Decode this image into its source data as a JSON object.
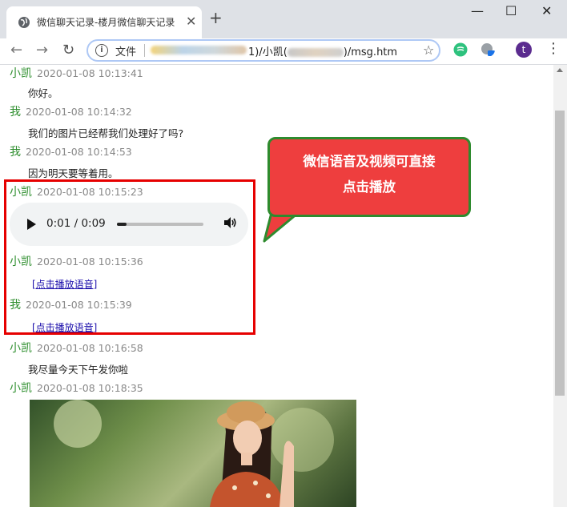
{
  "browser": {
    "tab_title": "微信聊天记录-楼月微信聊天记录",
    "tab_close_glyph": "✕",
    "new_tab_glyph": "+",
    "window_controls": [
      "—",
      "☐",
      "✕"
    ],
    "nav": {
      "back": "←",
      "forward": "→",
      "reload": "↻"
    },
    "address": {
      "info_glyph": "i",
      "file_label": "文件",
      "url_visible_1": "1)/小凯(",
      "url_visible_2": ")/msg.htm"
    },
    "star_glyph": "☆",
    "profile_initial": "t",
    "menu_glyph": "⋮",
    "colors": {
      "ext_green": "#2ec27e",
      "ext_gray": "#9aa0a6",
      "ext_blue": "#1a73e8",
      "avatar": "#5b2c8f"
    }
  },
  "messages": [
    {
      "sender": "小凯",
      "time": "2020-01-08 10:13:41",
      "text": "你好。"
    },
    {
      "sender": "我",
      "time": "2020-01-08 10:14:32",
      "text": "我们的图片已经帮我们处理好了吗?"
    },
    {
      "sender": "我",
      "time": "2020-01-08 10:14:53",
      "text": "因为明天要等着用。"
    },
    {
      "sender": "小凯",
      "time": "2020-01-08 10:15:23",
      "audio": {
        "time_label": "0:01 / 0:09",
        "progress": 0.11
      }
    },
    {
      "sender": "小凯",
      "time": "2020-01-08 10:15:36",
      "link": "[点击播放语音]"
    },
    {
      "sender": "我",
      "time": "2020-01-08 10:15:39",
      "link": "[点击播放语音]"
    },
    {
      "sender": "小凯",
      "time": "2020-01-08 10:16:58",
      "text": "我尽量今天下午发你啦"
    },
    {
      "sender": "小凯",
      "time": "2020-01-08 10:18:35",
      "image": "photo"
    }
  ],
  "callout": {
    "text": "微信语音及视频可直接\n点击播放"
  }
}
